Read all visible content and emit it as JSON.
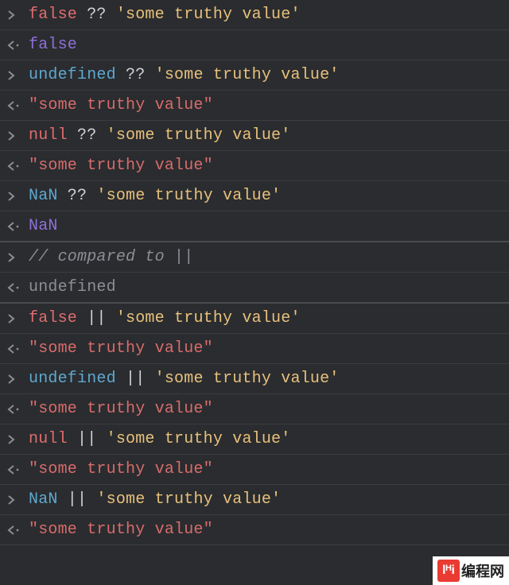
{
  "lines": [
    {
      "kind": "in",
      "tokens": [
        [
          "keyword",
          "false"
        ],
        [
          "op",
          " ?? "
        ],
        [
          "string",
          "'some truthy value'"
        ]
      ]
    },
    {
      "kind": "out",
      "tokens": [
        [
          "out-keyword",
          "false"
        ]
      ]
    },
    {
      "kind": "in",
      "tokens": [
        [
          "undefined",
          "undefined"
        ],
        [
          "op",
          " ?? "
        ],
        [
          "string",
          "'some truthy value'"
        ]
      ]
    },
    {
      "kind": "out",
      "tokens": [
        [
          "out-string",
          "\"some truthy value\""
        ]
      ]
    },
    {
      "kind": "in",
      "tokens": [
        [
          "keyword",
          "null"
        ],
        [
          "op",
          " ?? "
        ],
        [
          "string",
          "'some truthy value'"
        ]
      ]
    },
    {
      "kind": "out",
      "tokens": [
        [
          "out-string",
          "\"some truthy value\""
        ]
      ]
    },
    {
      "kind": "in",
      "tokens": [
        [
          "nan",
          "NaN"
        ],
        [
          "op",
          " ?? "
        ],
        [
          "string",
          "'some truthy value'"
        ]
      ]
    },
    {
      "kind": "out",
      "tokens": [
        [
          "out-keyword",
          "NaN"
        ]
      ],
      "sep": true
    },
    {
      "kind": "in",
      "tokens": [
        [
          "comment",
          "// compared to ||"
        ]
      ]
    },
    {
      "kind": "out",
      "tokens": [
        [
          "out-undef",
          "undefined"
        ]
      ],
      "sep": true
    },
    {
      "kind": "in",
      "tokens": [
        [
          "keyword",
          "false"
        ],
        [
          "op",
          " || "
        ],
        [
          "string",
          "'some truthy value'"
        ]
      ]
    },
    {
      "kind": "out",
      "tokens": [
        [
          "out-string",
          "\"some truthy value\""
        ]
      ]
    },
    {
      "kind": "in",
      "tokens": [
        [
          "undefined",
          "undefined"
        ],
        [
          "op",
          " || "
        ],
        [
          "string",
          "'some truthy value'"
        ]
      ]
    },
    {
      "kind": "out",
      "tokens": [
        [
          "out-string",
          "\"some truthy value\""
        ]
      ]
    },
    {
      "kind": "in",
      "tokens": [
        [
          "keyword",
          "null"
        ],
        [
          "op",
          " || "
        ],
        [
          "string",
          "'some truthy value'"
        ]
      ]
    },
    {
      "kind": "out",
      "tokens": [
        [
          "out-string",
          "\"some truthy value\""
        ]
      ]
    },
    {
      "kind": "in",
      "tokens": [
        [
          "nan",
          "NaN"
        ],
        [
          "op",
          " || "
        ],
        [
          "string",
          "'some truthy value'"
        ]
      ]
    },
    {
      "kind": "out",
      "tokens": [
        [
          "out-string",
          "\"some truthy value\""
        ]
      ]
    }
  ],
  "watermark": {
    "icon": "lᴴi",
    "text": "编程网"
  }
}
